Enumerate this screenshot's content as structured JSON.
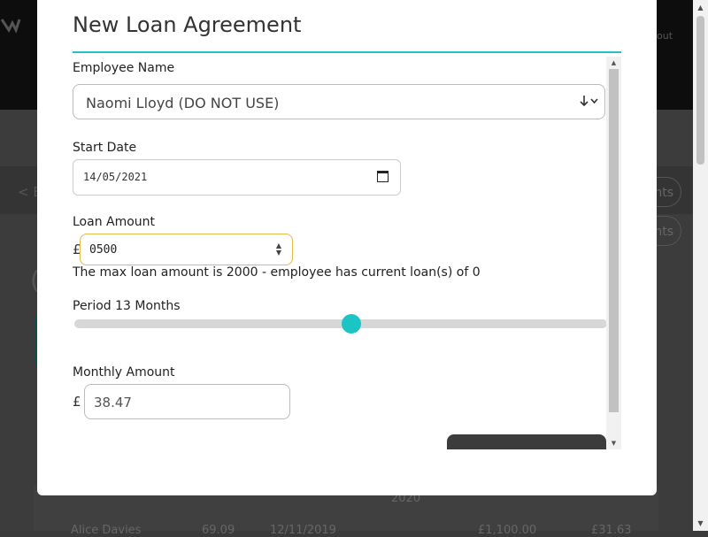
{
  "background": {
    "logout_fragment": "out",
    "back_fragment": "< E",
    "pill_fragment_1": "nts",
    "pill_fragment_2": "nts",
    "paren_fragment": "(",
    "year_text": "2020",
    "row_name": "Alice Davies",
    "row_val1": "69.09",
    "row_date": "12/11/2019",
    "row_val2": "£1,100.00",
    "row_val3": "£31.63"
  },
  "modal": {
    "title": "New Loan Agreement",
    "employee_label": "Employee Name",
    "employee_value": "Naomi Lloyd (DO NOT USE)",
    "start_date_label": "Start Date",
    "start_date_value": "14/05/2021",
    "loan_amount_label": "Loan Amount",
    "currency_symbol": "£",
    "loan_amount_value": "0500",
    "max_note": "The max loan amount is 2000 - employee has current loan(s) of 0",
    "period_label": "Period 13 Months",
    "period_slider_fraction": 0.52,
    "monthly_label": "Monthly Amount",
    "monthly_value": "38.47"
  },
  "colors": {
    "accent": "#20c6c6",
    "focus_border": "#e5b84a"
  },
  "icons": {
    "select_arrow": "arrow-down-chevron-icon",
    "calendar": "calendar-icon",
    "spinner": "spinner-arrows-icon"
  }
}
